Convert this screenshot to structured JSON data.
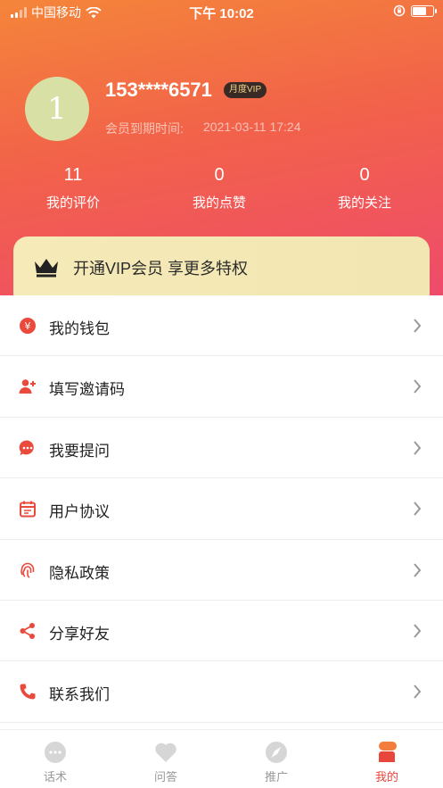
{
  "status_bar": {
    "carrier": "中国移动",
    "time": "下午 10:02"
  },
  "profile": {
    "avatar_letter": "1",
    "phone": "153****6571",
    "vip_badge": "月度VIP",
    "expire_label": "会员到期时间:",
    "expire_value": "2021-03-11 17:24"
  },
  "stats": [
    {
      "value": "11",
      "label": "我的评价"
    },
    {
      "value": "0",
      "label": "我的点赞"
    },
    {
      "value": "0",
      "label": "我的关注"
    }
  ],
  "vip_promo": {
    "icon": "crown-icon",
    "text": "开通VIP会员 享更多特权"
  },
  "menu": [
    {
      "label": "我的钱包",
      "icon": "wallet-icon"
    },
    {
      "label": "填写邀请码",
      "icon": "add-user-icon"
    },
    {
      "label": "我要提问",
      "icon": "chat-bubble-icon"
    },
    {
      "label": "用户协议",
      "icon": "calendar-icon"
    },
    {
      "label": "隐私政策",
      "icon": "fingerprint-icon"
    },
    {
      "label": "分享好友",
      "icon": "share-icon"
    },
    {
      "label": "联系我们",
      "icon": "phone-icon"
    }
  ],
  "tabbar": [
    {
      "label": "话术",
      "icon": "chat-icon",
      "active": false
    },
    {
      "label": "问答",
      "icon": "heart-icon",
      "active": false
    },
    {
      "label": "推广",
      "icon": "compass-icon",
      "active": false
    },
    {
      "label": "我的",
      "icon": "profile-icon",
      "active": true
    }
  ],
  "colors": {
    "accent": "#e8453c",
    "header_start": "#f4853a",
    "header_end": "#ee4a6c",
    "vip_card": "#f5eab8",
    "tab_inactive": "#999999"
  }
}
